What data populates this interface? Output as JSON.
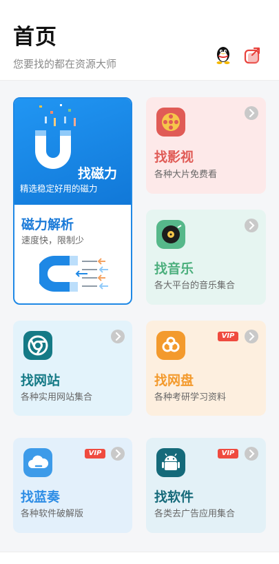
{
  "header": {
    "title": "首页",
    "subtitle": "您要找的都在资源大师",
    "qq_icon": "penguin-icon",
    "share_icon": "share-icon"
  },
  "colors": {
    "magnet_blue": "#1e88e5",
    "vip_red": "#ef4b3f",
    "video_red": "#e05b56",
    "music_green": "#4caf7d",
    "site_teal": "#157a86",
    "pan_orange": "#f39a2d",
    "lanzou_blue": "#2e8de5",
    "software_teal": "#156a7a"
  },
  "cards": {
    "magnet": {
      "banner_title": "找磁力",
      "banner_desc": "精选稳定好用的磁力",
      "title": "磁力解析",
      "desc": "速度快，限制少",
      "icon": "magnet-icon"
    },
    "video": {
      "title": "找影视",
      "desc": "各种大片免费看",
      "icon": "film-reel-icon"
    },
    "music": {
      "title": "找音乐",
      "desc": "各大平台的音乐集合",
      "icon": "vinyl-record-icon"
    },
    "site": {
      "title": "找网站",
      "desc": "各种实用网站集合",
      "icon": "chrome-icon"
    },
    "pan": {
      "title": "找网盘",
      "desc": "各种考研学习资料",
      "icon": "cloud-disk-icon",
      "badge": "VIP"
    },
    "lanzou": {
      "title": "找蓝奏",
      "desc": "各种软件破解版",
      "icon": "cloud-icon",
      "badge": "VIP"
    },
    "software": {
      "title": "找软件",
      "desc": "各类去广告应用集合",
      "icon": "android-icon",
      "badge": "VIP"
    }
  }
}
